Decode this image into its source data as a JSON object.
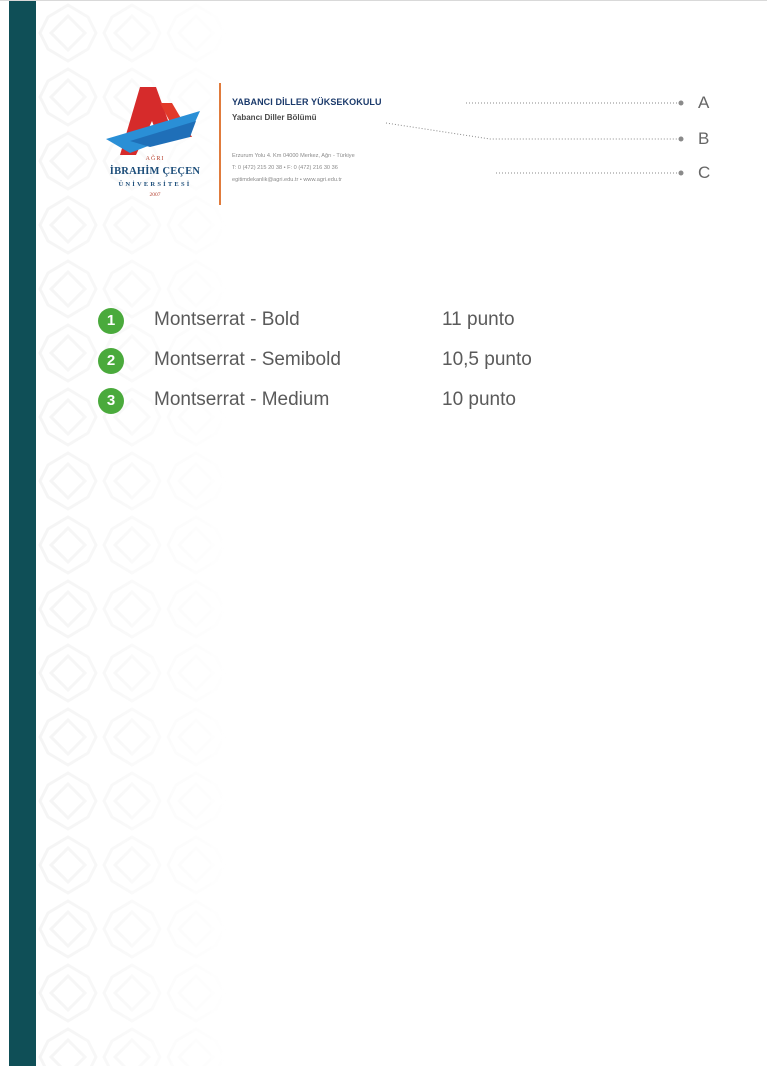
{
  "letterhead": {
    "logo": {
      "line1": "AĞRI",
      "line2": "İBRAHİM ÇEÇEN",
      "line3": "ÜNİVERSİTESİ",
      "line4": "2007"
    },
    "org_name": "YABANCI DİLLER YÜKSEKOKULU",
    "department": "Yabancı Diller Bölümü",
    "address_lines": [
      "Erzurum Yolu 4. Km 04000 Merkez, Ağrı - Türkiye",
      "T: 0 (472) 215 20 38 • F: 0 (472) 216 30 36",
      "egitimdekanlik@agri.edu.tr • www.agri.edu.tr"
    ],
    "markers": [
      "A",
      "B",
      "C"
    ]
  },
  "font_specs": [
    {
      "number": "1",
      "font": "Montserrat - Bold",
      "size": "11 punto"
    },
    {
      "number": "2",
      "font": "Montserrat - Semibold",
      "size": "10,5 punto"
    },
    {
      "number": "3",
      "font": "Montserrat - Medium",
      "size": "10 punto"
    }
  ],
  "colors": {
    "stripe": "#0f4f57",
    "badge": "#4aaa3c",
    "accent_line": "#e07b3c",
    "logo_red": "#d62b2b",
    "logo_blue": "#2a8fd6"
  }
}
